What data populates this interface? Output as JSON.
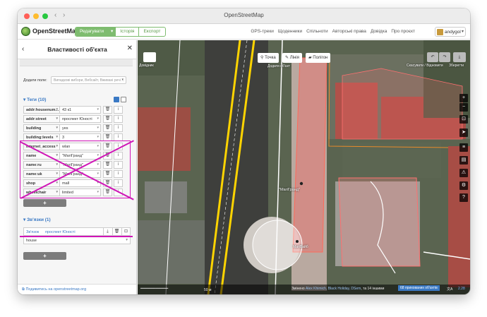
{
  "window": {
    "title": "OpenStreetMap"
  },
  "header": {
    "brand": "OpenStreetMap",
    "edit_label": "Редагувати",
    "edit_dropdown": "▾",
    "history_label": "Історія",
    "export_label": "Експорт",
    "links": [
      "GPS-треки",
      "Щоденники",
      "Спільноти",
      "Авторські права",
      "Довідка",
      "Про проєкт"
    ],
    "user": "andygol"
  },
  "sidebar": {
    "back_icon": "‹",
    "title": "Властивості об'єкта",
    "close_icon": "✕",
    "add_field_label": "Додати поле:",
    "add_field_placeholder": "Випадкові вибори, Вебсайт, Вживані речі ...",
    "tags_title": "Теги (10)",
    "tags": [
      {
        "key": "addr:housenum...",
        "value": "43 к1"
      },
      {
        "key": "addr:street",
        "value": "проспект Юності"
      },
      {
        "key": "building",
        "value": "yes"
      },
      {
        "key": "building:levels",
        "value": "3"
      },
      {
        "key": "internet_access",
        "value": "wlan"
      },
      {
        "key": "name",
        "value": "\"МагіГранд\""
      },
      {
        "key": "name:ru",
        "value": "\"МагіГранд\""
      },
      {
        "key": "name:uk",
        "value": "\"МагіГранд\""
      },
      {
        "key": "shop",
        "value": "mall"
      },
      {
        "key": "wheelchair",
        "value": "limited"
      }
    ],
    "add_tag_label": "+",
    "relations_title": "Зв'язки (1)",
    "relation_type": "Зв'язок",
    "relation_name": "проспект Юності",
    "relation_role": "house",
    "add_relation_label": "+",
    "footer_link": "Подивитись на openstreetmap.org"
  },
  "map": {
    "background_btn": "Довідник",
    "modes": [
      "Точка",
      "Лінія",
      "Полігон"
    ],
    "undo_redo": "Скасувати / Відновити",
    "save": "Зберегти",
    "add_feature": "Додати об'єкт",
    "labels": {
      "building_name": "\"МагіГранд\"",
      "poi_name": "МагіВайб"
    },
    "scale": "50 м",
    "attribution_prefix": "Змінено",
    "attribution_names": "Alex Khimich, Black Holiday, DSem",
    "attribution_suffix": "та 14 іншими",
    "hidden_objects": "68 прихованих об'єктів",
    "zoom_label": "2.28"
  }
}
